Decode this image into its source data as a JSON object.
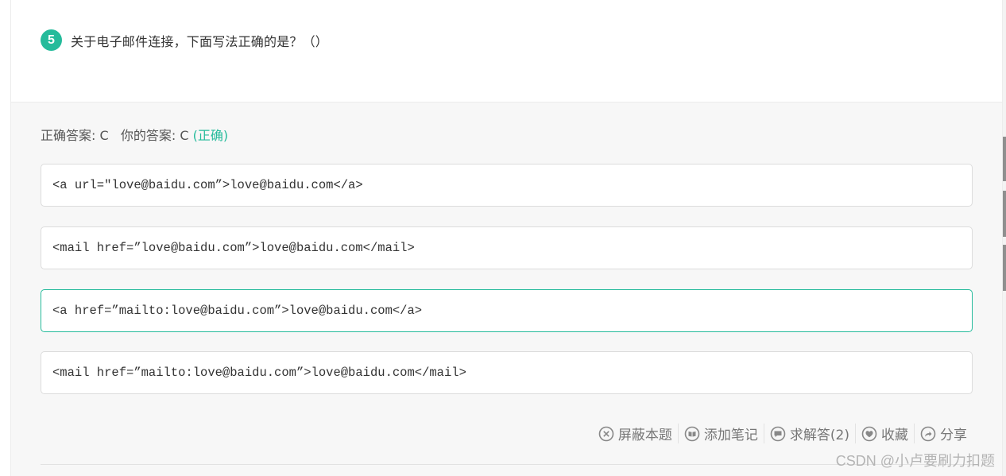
{
  "question": {
    "number": "5",
    "text": "关于电子邮件连接，下面写法正确的是？（）"
  },
  "result": {
    "correct_label": "正确答案: C",
    "your_label": "你的答案: C",
    "status": "(正确)"
  },
  "options": [
    {
      "text": "<a url=\"love@baidu.com”>love@baidu.com</a>",
      "selected": false
    },
    {
      "text": "<mail href=”love@baidu.com”>love@baidu.com</mail>",
      "selected": false
    },
    {
      "text": "<a href=”mailto:love@baidu.com”>love@baidu.com</a>",
      "selected": true
    },
    {
      "text": "<mail href=”mailto:love@baidu.com”>love@baidu.com</mail>",
      "selected": false
    }
  ],
  "toolbar": {
    "block_label": "屏蔽本题",
    "block_icon": "close-circle-icon",
    "note_label": "添加笔记",
    "note_icon": "book-icon",
    "ask_label": "求解答(2)",
    "ask_icon": "chat-bubble-icon",
    "fav_label": "收藏",
    "fav_icon": "heart-icon",
    "share_label": "分享",
    "share_icon": "share-icon"
  },
  "watermark": "CSDN @小卢要刷力扣题",
  "colors": {
    "accent": "#25bb9b",
    "panel_bg": "#f7f7f7",
    "border": "#dcdcdc"
  }
}
